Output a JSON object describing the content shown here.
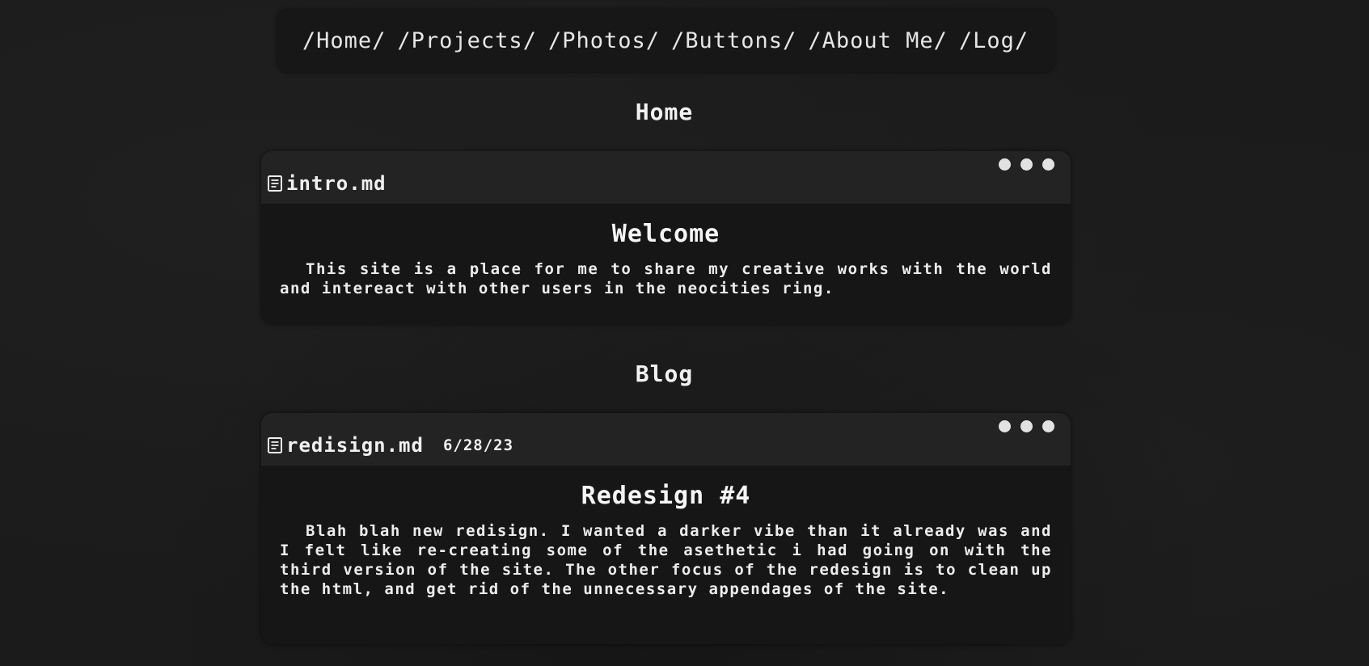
{
  "nav": {
    "items": [
      "/Home/",
      "/Projects/",
      "/Photos/",
      "/Buttons/",
      "/About Me/",
      "/Log/"
    ]
  },
  "home": {
    "section_title": "Home",
    "window": {
      "file_name": "intro.md",
      "heading": "Welcome",
      "body": "This site is a place for me to share my creative works with the world and intereact with other users in the neocities ring."
    }
  },
  "blog": {
    "section_title": "Blog",
    "window": {
      "file_name": "redisign.md",
      "date": "6/28/23",
      "heading": "Redesign #4",
      "body": "Blah blah new redisign. I wanted a darker vibe than it already was and I felt like re-creating some of the asethetic i had going on with the third version of the site. The other focus of the redesign is to clean up the html, and get rid of the unnecessary appendages of the site."
    }
  },
  "icons": {
    "file": "document-icon",
    "window_controls": "dot-icon"
  },
  "colors": {
    "background": "#1b1b1b",
    "panel": "#161616",
    "titlebar": "#232323",
    "text": "#ececec"
  }
}
